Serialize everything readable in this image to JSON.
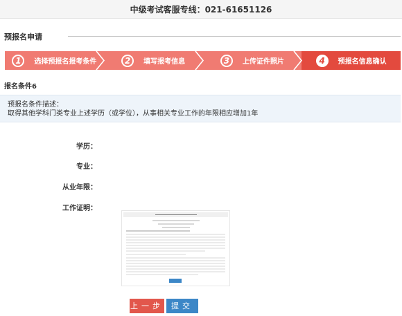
{
  "header": {
    "hotline": "中级考试客服专线：021-61651126"
  },
  "section": {
    "title": "预报名申请"
  },
  "steps": [
    {
      "num": "1",
      "label": "选择预报名报考条件"
    },
    {
      "num": "2",
      "label": "填写报考信息"
    },
    {
      "num": "3",
      "label": "上传证件照片"
    },
    {
      "num": "4",
      "label": "预报名信息确认"
    }
  ],
  "active_step": 4,
  "condition": {
    "title": "报名条件6",
    "desc_label": "预报名条件描述：",
    "desc_text": "取得其他学科门类专业上述学历（或学位），从事相关专业工作的年限相应增加1年"
  },
  "form": {
    "education_label": "学历：",
    "education_value": "",
    "major_label": "专业：",
    "major_value": "",
    "years_label": "从业年限：",
    "years_value": "",
    "certificate_label": "工作证明："
  },
  "buttons": {
    "prev": "上一步",
    "submit": "提交"
  },
  "colors": {
    "step": "#f07b72",
    "step_active": "#e34a3e",
    "prev_button": "#e2574c",
    "submit_button": "#3c87c7",
    "desc_bg": "#eef4fa"
  }
}
